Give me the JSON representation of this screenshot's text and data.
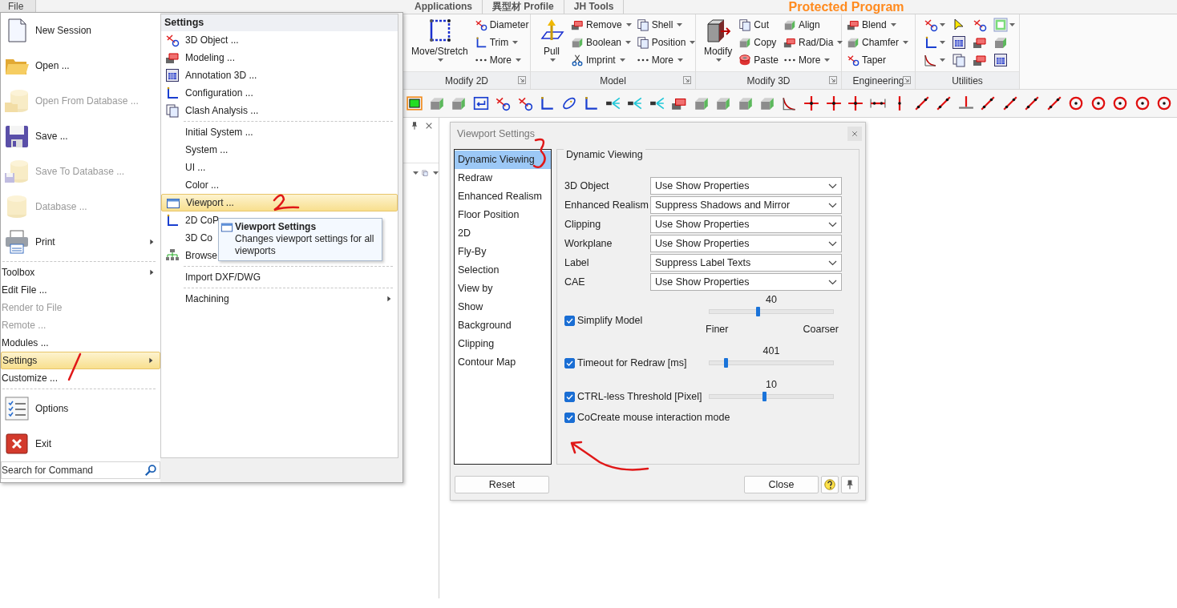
{
  "file_tab": {
    "label": "File"
  },
  "ribbon_tabs": [
    {
      "label": "Applications"
    },
    {
      "label": "異型材 Profile"
    },
    {
      "label": "JH Tools"
    }
  ],
  "banner": "Protected Program",
  "ribbon": {
    "groups": [
      {
        "label": "Modify 2D",
        "launcher": true,
        "items": [
          {
            "kind": "large",
            "label": "Move/Stretch",
            "dropdown": true
          },
          {
            "kind": "small",
            "label": "Diameter",
            "dropdown": false
          },
          {
            "kind": "small",
            "label": "Trim",
            "dropdown": true
          },
          {
            "kind": "more",
            "label": "More",
            "dropdown": true
          }
        ]
      },
      {
        "label": "Model",
        "launcher": true,
        "items": [
          {
            "kind": "large",
            "label": "Pull",
            "dropdown": true
          },
          {
            "kind": "small",
            "label": "Remove",
            "dropdown": true
          },
          {
            "kind": "small",
            "label": "Boolean",
            "dropdown": true
          },
          {
            "kind": "small",
            "label": "Imprint",
            "dropdown": true
          },
          {
            "kind": "small",
            "label": "Shell",
            "dropdown": true
          },
          {
            "kind": "small",
            "label": "Position",
            "dropdown": true
          },
          {
            "kind": "more",
            "label": "More",
            "dropdown": true
          }
        ]
      },
      {
        "label": "Modify 3D",
        "launcher": true,
        "items": [
          {
            "kind": "large",
            "label": "Modify",
            "dropdown": true
          },
          {
            "kind": "small",
            "label": "Cut",
            "dropdown": false
          },
          {
            "kind": "small",
            "label": "Copy",
            "dropdown": false
          },
          {
            "kind": "small",
            "label": "Paste",
            "dropdown": false
          },
          {
            "kind": "small",
            "label": "Align",
            "dropdown": false
          },
          {
            "kind": "small",
            "label": "Rad/Dia",
            "dropdown": true
          },
          {
            "kind": "more",
            "label": "More",
            "dropdown": true
          }
        ]
      },
      {
        "label": "Engineering",
        "launcher": true,
        "items": [
          {
            "kind": "small",
            "label": "Blend",
            "dropdown": true
          },
          {
            "kind": "small",
            "label": "Chamfer",
            "dropdown": true
          },
          {
            "kind": "small",
            "label": "Taper",
            "dropdown": false
          }
        ]
      },
      {
        "label": "Utilities",
        "launcher": false
      }
    ]
  },
  "file_menu": {
    "items": [
      {
        "kind": "large",
        "label": "New Session",
        "disabled": false,
        "submenu": false,
        "selected": false
      },
      {
        "kind": "large",
        "label": "Open ...",
        "disabled": false,
        "submenu": false,
        "selected": false
      },
      {
        "kind": "large",
        "label": "Open From Database ...",
        "disabled": true,
        "submenu": false,
        "selected": false
      },
      {
        "kind": "large",
        "label": "Save ...",
        "disabled": false,
        "submenu": false,
        "selected": false
      },
      {
        "kind": "large",
        "label": "Save To Database ...",
        "disabled": true,
        "submenu": false,
        "selected": false
      },
      {
        "kind": "large",
        "label": "Database ...",
        "disabled": true,
        "submenu": false,
        "selected": false
      },
      {
        "kind": "large",
        "label": "Print",
        "disabled": false,
        "submenu": true,
        "selected": false
      },
      {
        "kind": "separator"
      },
      {
        "kind": "small",
        "label": "Toolbox",
        "disabled": false,
        "submenu": true,
        "selected": false
      },
      {
        "kind": "small",
        "label": "Edit File ...",
        "disabled": false,
        "submenu": false,
        "selected": false
      },
      {
        "kind": "small",
        "label": "Render to File",
        "disabled": true,
        "submenu": false,
        "selected": false
      },
      {
        "kind": "small",
        "label": "Remote ...",
        "disabled": true,
        "submenu": false,
        "selected": false
      },
      {
        "kind": "small",
        "label": "Modules ...",
        "disabled": false,
        "submenu": false,
        "selected": false
      },
      {
        "kind": "small",
        "label": "Settings",
        "disabled": false,
        "submenu": true,
        "selected": true
      },
      {
        "kind": "small",
        "label": "Customize ...",
        "disabled": false,
        "submenu": false,
        "selected": false
      },
      {
        "kind": "separator"
      },
      {
        "kind": "large",
        "label": "Options",
        "disabled": false,
        "submenu": false,
        "selected": false
      },
      {
        "kind": "large",
        "label": "Exit",
        "disabled": false,
        "submenu": false,
        "selected": false
      }
    ],
    "search": {
      "placeholder": "Search for Command"
    }
  },
  "settings_menu": {
    "title": "Settings",
    "items": [
      {
        "kind": "icon_item",
        "label": "3D Object ...",
        "selected": false,
        "submenu": false
      },
      {
        "kind": "icon_item",
        "label": "Modeling ...",
        "selected": false,
        "submenu": false
      },
      {
        "kind": "icon_item",
        "label": "Annotation 3D ...",
        "selected": false,
        "submenu": false
      },
      {
        "kind": "icon_item",
        "label": "Configuration ...",
        "selected": false,
        "submenu": false
      },
      {
        "kind": "icon_item",
        "label": "Clash Analysis ...",
        "selected": false,
        "submenu": false
      },
      {
        "kind": "separator"
      },
      {
        "kind": "item",
        "label": "Initial System ...",
        "selected": false,
        "submenu": false
      },
      {
        "kind": "item",
        "label": "System ...",
        "selected": false,
        "submenu": false
      },
      {
        "kind": "item",
        "label": "UI ...",
        "selected": false,
        "submenu": false
      },
      {
        "kind": "item",
        "label": "Color ...",
        "selected": false,
        "submenu": false
      },
      {
        "kind": "icon_item",
        "label": "Viewport ...",
        "selected": true,
        "submenu": false
      },
      {
        "kind": "icon_item",
        "label": "2D CoP",
        "selected": false,
        "submenu": false
      },
      {
        "kind": "item",
        "label": "3D Co",
        "selected": false,
        "submenu": false
      },
      {
        "kind": "icon_item",
        "label": "Browse",
        "selected": false,
        "submenu": false
      },
      {
        "kind": "separator"
      },
      {
        "kind": "item",
        "label": "Import DXF/DWG",
        "selected": false,
        "submenu": false
      },
      {
        "kind": "separator"
      },
      {
        "kind": "item",
        "label": "Machining",
        "selected": false,
        "submenu": true
      }
    ]
  },
  "tooltip": {
    "title": "Viewport Settings",
    "text": "Changes viewport settings for all viewports"
  },
  "dialog": {
    "title": "Viewport Settings",
    "categories": [
      {
        "label": "Dynamic Viewing",
        "selected": true
      },
      {
        "label": "Redraw",
        "selected": false
      },
      {
        "label": "Enhanced Realism",
        "selected": false
      },
      {
        "label": "Floor Position",
        "selected": false
      },
      {
        "label": "2D",
        "selected": false
      },
      {
        "label": "Fly-By",
        "selected": false
      },
      {
        "label": "Selection",
        "selected": false
      },
      {
        "label": "View by",
        "selected": false
      },
      {
        "label": "Show",
        "selected": false
      },
      {
        "label": "Background",
        "selected": false
      },
      {
        "label": "Clipping",
        "selected": false
      },
      {
        "label": "Contour Map",
        "selected": false
      }
    ],
    "panel": {
      "legend": "Dynamic Viewing",
      "fields": [
        {
          "label": "3D Object",
          "value": "Use Show Properties"
        },
        {
          "label": "Enhanced Realism",
          "value": "Suppress Shadows and Mirror"
        },
        {
          "label": "Clipping",
          "value": "Use Show Properties"
        },
        {
          "label": "Workplane",
          "value": "Use Show Properties"
        },
        {
          "label": "Label",
          "value": "Suppress Label Texts"
        },
        {
          "label": "CAE",
          "value": "Use Show Properties"
        }
      ],
      "options": [
        {
          "kind": "slider",
          "label": "Simplify Model",
          "checked": true,
          "reading": "40",
          "level": 0.39,
          "min_label": "Finer",
          "max_label": "Coarser"
        },
        {
          "kind": "slider",
          "label": "Timeout for Redraw [ms]",
          "checked": true,
          "reading": "401",
          "level": 0.13
        },
        {
          "kind": "slider",
          "label": "CTRL-less Threshold [Pixel]",
          "checked": true,
          "reading": "10",
          "level": 0.44
        },
        {
          "kind": "check",
          "label": "CoCreate mouse interaction mode",
          "checked": true
        }
      ]
    },
    "buttons": [
      {
        "kind": "text",
        "label": "Reset"
      },
      {
        "kind": "text",
        "label": "Close"
      },
      {
        "kind": "help"
      },
      {
        "kind": "pin"
      }
    ]
  }
}
